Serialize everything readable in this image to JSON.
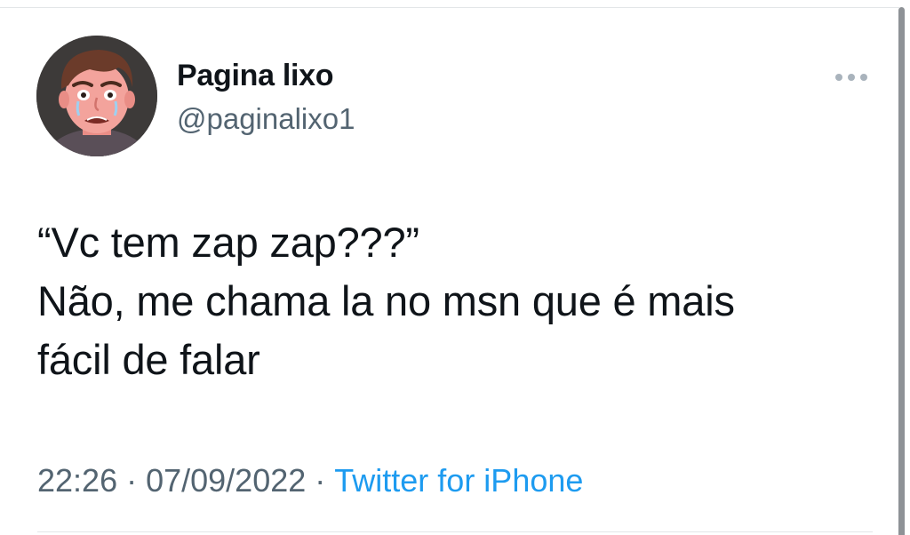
{
  "author": {
    "display_name": "Pagina lixo",
    "handle": "@paginalixo1",
    "avatar_icon": "avatar-cartoon-crying-face"
  },
  "tweet": {
    "lines": [
      "“Vc tem zap zap???”",
      "Não, me chama la no msn que é mais",
      "fácil de falar"
    ]
  },
  "meta": {
    "time": "22:26",
    "separator": "·",
    "date": "07/09/2022",
    "source": "Twitter for iPhone"
  },
  "menu": {
    "icon": "more-horizontal-icon"
  },
  "colors": {
    "text": "#0f1419",
    "secondary": "#536471",
    "link": "#1d9bf0",
    "divider": "#e3e6e8"
  }
}
